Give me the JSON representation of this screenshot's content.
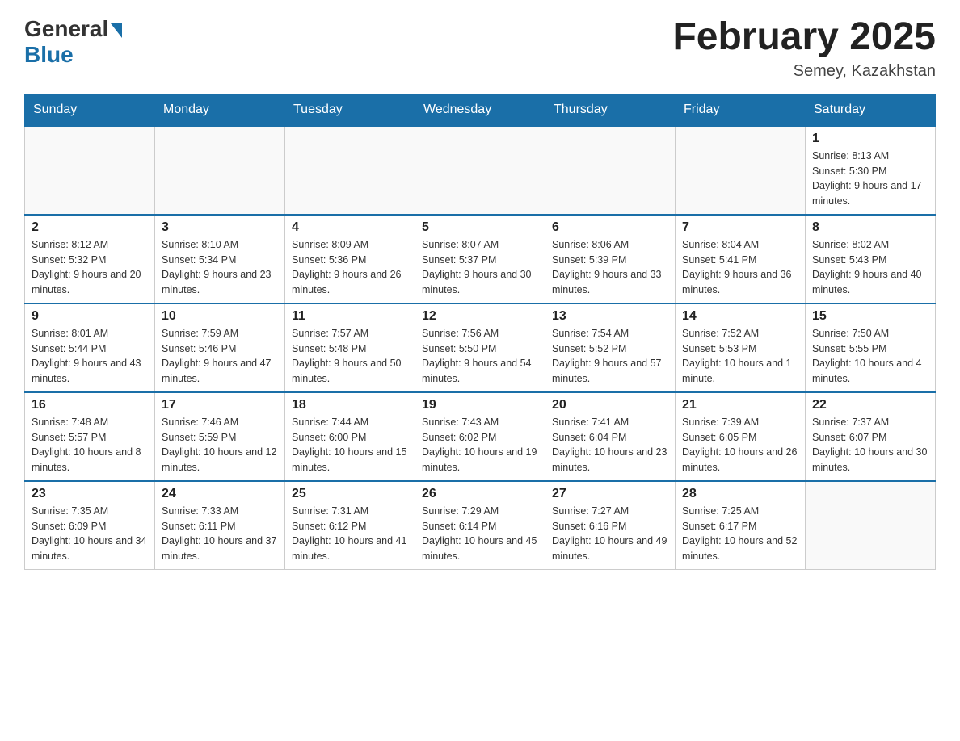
{
  "header": {
    "logo_general": "General",
    "logo_blue": "Blue",
    "title": "February 2025",
    "subtitle": "Semey, Kazakhstan"
  },
  "weekdays": [
    "Sunday",
    "Monday",
    "Tuesday",
    "Wednesday",
    "Thursday",
    "Friday",
    "Saturday"
  ],
  "weeks": [
    [
      {
        "day": "",
        "info": ""
      },
      {
        "day": "",
        "info": ""
      },
      {
        "day": "",
        "info": ""
      },
      {
        "day": "",
        "info": ""
      },
      {
        "day": "",
        "info": ""
      },
      {
        "day": "",
        "info": ""
      },
      {
        "day": "1",
        "info": "Sunrise: 8:13 AM\nSunset: 5:30 PM\nDaylight: 9 hours and 17 minutes."
      }
    ],
    [
      {
        "day": "2",
        "info": "Sunrise: 8:12 AM\nSunset: 5:32 PM\nDaylight: 9 hours and 20 minutes."
      },
      {
        "day": "3",
        "info": "Sunrise: 8:10 AM\nSunset: 5:34 PM\nDaylight: 9 hours and 23 minutes."
      },
      {
        "day": "4",
        "info": "Sunrise: 8:09 AM\nSunset: 5:36 PM\nDaylight: 9 hours and 26 minutes."
      },
      {
        "day": "5",
        "info": "Sunrise: 8:07 AM\nSunset: 5:37 PM\nDaylight: 9 hours and 30 minutes."
      },
      {
        "day": "6",
        "info": "Sunrise: 8:06 AM\nSunset: 5:39 PM\nDaylight: 9 hours and 33 minutes."
      },
      {
        "day": "7",
        "info": "Sunrise: 8:04 AM\nSunset: 5:41 PM\nDaylight: 9 hours and 36 minutes."
      },
      {
        "day": "8",
        "info": "Sunrise: 8:02 AM\nSunset: 5:43 PM\nDaylight: 9 hours and 40 minutes."
      }
    ],
    [
      {
        "day": "9",
        "info": "Sunrise: 8:01 AM\nSunset: 5:44 PM\nDaylight: 9 hours and 43 minutes."
      },
      {
        "day": "10",
        "info": "Sunrise: 7:59 AM\nSunset: 5:46 PM\nDaylight: 9 hours and 47 minutes."
      },
      {
        "day": "11",
        "info": "Sunrise: 7:57 AM\nSunset: 5:48 PM\nDaylight: 9 hours and 50 minutes."
      },
      {
        "day": "12",
        "info": "Sunrise: 7:56 AM\nSunset: 5:50 PM\nDaylight: 9 hours and 54 minutes."
      },
      {
        "day": "13",
        "info": "Sunrise: 7:54 AM\nSunset: 5:52 PM\nDaylight: 9 hours and 57 minutes."
      },
      {
        "day": "14",
        "info": "Sunrise: 7:52 AM\nSunset: 5:53 PM\nDaylight: 10 hours and 1 minute."
      },
      {
        "day": "15",
        "info": "Sunrise: 7:50 AM\nSunset: 5:55 PM\nDaylight: 10 hours and 4 minutes."
      }
    ],
    [
      {
        "day": "16",
        "info": "Sunrise: 7:48 AM\nSunset: 5:57 PM\nDaylight: 10 hours and 8 minutes."
      },
      {
        "day": "17",
        "info": "Sunrise: 7:46 AM\nSunset: 5:59 PM\nDaylight: 10 hours and 12 minutes."
      },
      {
        "day": "18",
        "info": "Sunrise: 7:44 AM\nSunset: 6:00 PM\nDaylight: 10 hours and 15 minutes."
      },
      {
        "day": "19",
        "info": "Sunrise: 7:43 AM\nSunset: 6:02 PM\nDaylight: 10 hours and 19 minutes."
      },
      {
        "day": "20",
        "info": "Sunrise: 7:41 AM\nSunset: 6:04 PM\nDaylight: 10 hours and 23 minutes."
      },
      {
        "day": "21",
        "info": "Sunrise: 7:39 AM\nSunset: 6:05 PM\nDaylight: 10 hours and 26 minutes."
      },
      {
        "day": "22",
        "info": "Sunrise: 7:37 AM\nSunset: 6:07 PM\nDaylight: 10 hours and 30 minutes."
      }
    ],
    [
      {
        "day": "23",
        "info": "Sunrise: 7:35 AM\nSunset: 6:09 PM\nDaylight: 10 hours and 34 minutes."
      },
      {
        "day": "24",
        "info": "Sunrise: 7:33 AM\nSunset: 6:11 PM\nDaylight: 10 hours and 37 minutes."
      },
      {
        "day": "25",
        "info": "Sunrise: 7:31 AM\nSunset: 6:12 PM\nDaylight: 10 hours and 41 minutes."
      },
      {
        "day": "26",
        "info": "Sunrise: 7:29 AM\nSunset: 6:14 PM\nDaylight: 10 hours and 45 minutes."
      },
      {
        "day": "27",
        "info": "Sunrise: 7:27 AM\nSunset: 6:16 PM\nDaylight: 10 hours and 49 minutes."
      },
      {
        "day": "28",
        "info": "Sunrise: 7:25 AM\nSunset: 6:17 PM\nDaylight: 10 hours and 52 minutes."
      },
      {
        "day": "",
        "info": ""
      }
    ]
  ]
}
